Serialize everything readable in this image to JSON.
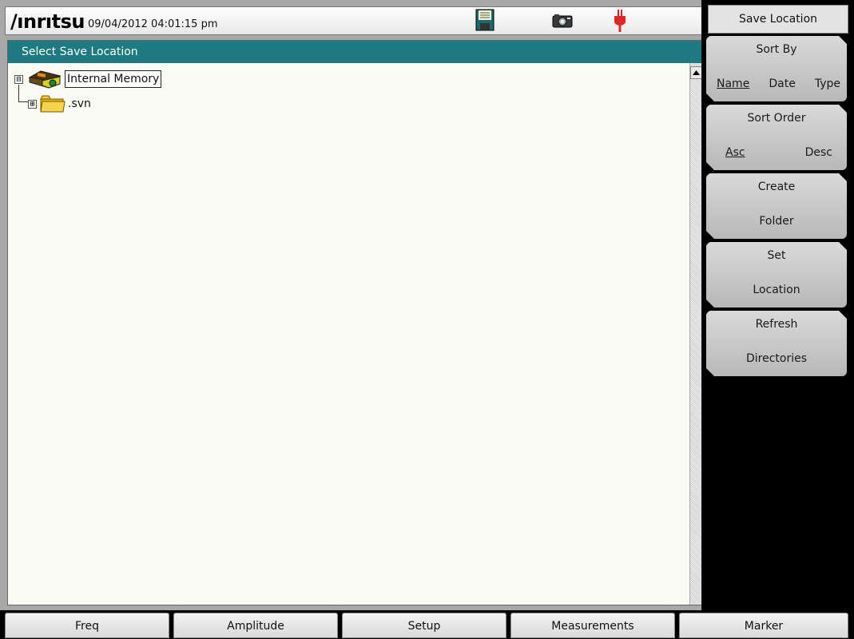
{
  "status_bar": {
    "brand": "/ınrıtsu",
    "datetime": "09/04/2012 04:01:15 pm",
    "icons": [
      "floppy-disk-icon",
      "camera-icon",
      "power-plug-icon"
    ]
  },
  "panel": {
    "title": "Select Save Location",
    "tree": [
      {
        "label": "Internal Memory",
        "expander": "⊟",
        "icon": "memory-device-icon",
        "selected": true
      },
      {
        "label": ".svn",
        "expander": "⊞",
        "icon": "folder-icon",
        "selected": false
      }
    ]
  },
  "softkeys": {
    "header": "Save Location",
    "sort_by": {
      "label": "Sort By",
      "options": [
        "Name",
        "Date",
        "Type"
      ],
      "selected": "Name"
    },
    "sort_order": {
      "label": "Sort Order",
      "options": [
        "Asc",
        "Desc"
      ],
      "selected": "Asc"
    },
    "create_folder": {
      "line1": "Create",
      "line2": "Folder"
    },
    "set_location": {
      "line1": "Set",
      "line2": "Location"
    },
    "refresh_directories": {
      "line1": "Refresh",
      "line2": "Directories"
    }
  },
  "bottom_tabs": [
    "Freq",
    "Amplitude",
    "Setup",
    "Measurements",
    "Marker"
  ],
  "colors": {
    "title_bar": "#1c7a80",
    "softkey": "#c8c8c8",
    "content_bg": "#fbfbf6"
  }
}
